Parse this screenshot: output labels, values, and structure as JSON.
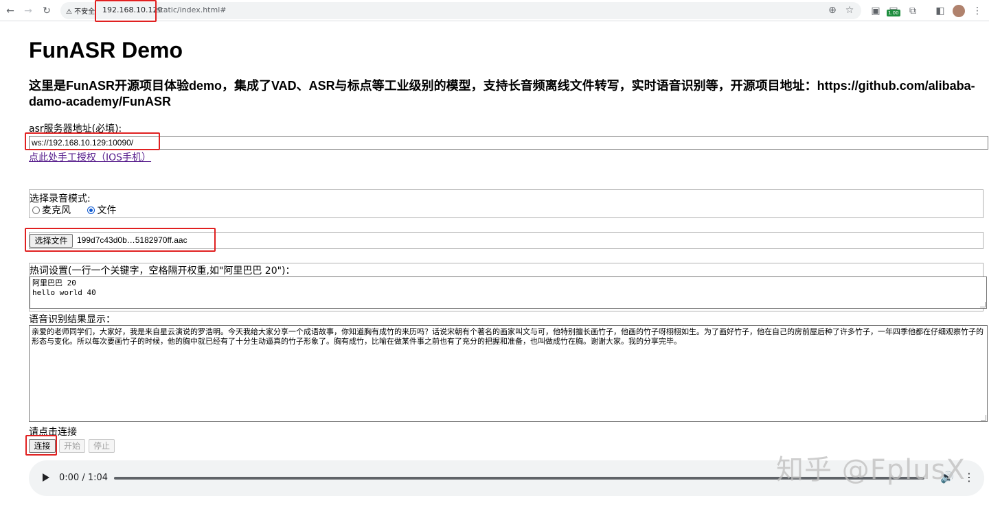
{
  "browser": {
    "insecure_label": "不安全",
    "url_host": "192.168.10.129",
    "url_path": "/static/index.html#",
    "extension_badge": "1.00"
  },
  "page": {
    "title": "FunASR Demo",
    "subtitle": "这里是FunASR开源项目体验demo，集成了VAD、ASR与标点等工业级别的模型，支持长音频离线文件转写，实时语音识别等，开源项目地址：https://github.com/alibaba-damo-academy/FunASR",
    "server_label": "asr服务器地址(必填):",
    "server_value": "ws://192.168.10.129:10090/",
    "auth_link": "点此处手工授权（IOS手机）",
    "mode_label": "选择录音模式:",
    "mode_options": [
      "麦克风",
      "文件"
    ],
    "mode_selected": "文件",
    "file_button": "选择文件",
    "file_name": "199d7c43d0b…5182970ff.aac",
    "hotword_label": "热词设置(一行一个关键字，空格隔开权重,如\"阿里巴巴 20\")：",
    "hotword_value": "阿里巴巴 20\nhello world 40",
    "result_label": "语音识别结果显示：",
    "result_value": "亲爱的老师同学们，大家好，我是来自星云演说的罗浩明。今天我给大家分享一个成语故事，你知道胸有成竹的来历吗？话说宋朝有个著名的画家叫文与可，他特别擅长画竹子，他画的竹子呀栩栩如生。为了画好竹子，他在自己的房前屋后种了许多竹子，一年四季他都在仔细观察竹子的形态与变化。所以每次要画竹子的时候，他的胸中就已经有了十分生动逼真的竹子形象了。胸有成竹，比喻在做某件事之前也有了充分的把握和准备，也叫做成竹在胸。谢谢大家。我的分享完毕。",
    "status_text": "请点击连接",
    "buttons": {
      "connect": "连接",
      "start": "开始",
      "stop": "停止"
    },
    "audio_time": "0:00 / 1:04"
  },
  "watermark": "知乎 @FplusX",
  "colors": {
    "highlight_box": "#e02020",
    "link": "#551a8b",
    "radio_accent": "#0b57d0"
  }
}
